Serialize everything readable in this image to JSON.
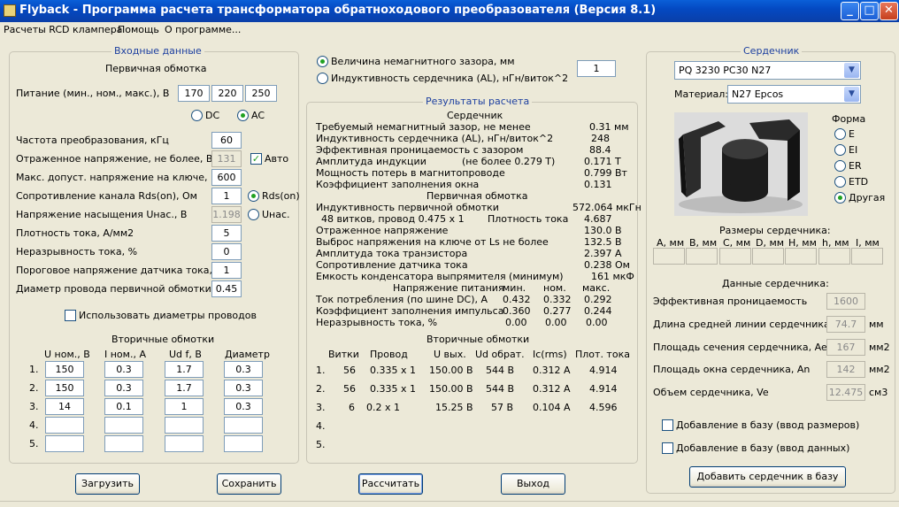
{
  "window": {
    "title": "Flyback - Программа расчета трансформатора обратноходового преобразователя (Версия 8.1)",
    "min": "_",
    "max": "□",
    "close": "✕"
  },
  "menu": [
    "Расчеты RCD клампера",
    "Помощь",
    "О программе..."
  ],
  "input": {
    "title": "Входные данные",
    "primary_title": "Первичная обмотка",
    "supply_label": "Питание (мин., ном., макс.), В",
    "supply": [
      "170",
      "220",
      "250"
    ],
    "dc": "DC",
    "ac": "AC",
    "rows": [
      {
        "label": "Частота преобразования, кГц",
        "value": "60"
      },
      {
        "label": "Отраженное напряжение, не более, В",
        "value": "131"
      },
      {
        "label": "Макс. допуст. напряжение на ключе, В",
        "value": "600"
      },
      {
        "label": "Сопротивление канала Rds(on), Ом",
        "value": "1"
      },
      {
        "label": "Напряжение насыщения Uнас., В",
        "value": "1.198"
      },
      {
        "label": "Плотность тока, А/мм2",
        "value": "5"
      },
      {
        "label": "Неразрывность тока, %",
        "value": "0"
      },
      {
        "label": "Пороговое напряжение датчика тока, В",
        "value": "1"
      },
      {
        "label": "Диаметр провода первичной обмотки",
        "value": "0.45"
      }
    ],
    "auto": "Авто",
    "rds_on": "Rds(on)",
    "u_sat": "Uнас.",
    "use_diam": "Использовать диаметры проводов",
    "secondary_title": "Вторичные обмотки",
    "sec_headers": [
      "U ном., В",
      "I ном., А",
      "Ud f, В",
      "Диаметр"
    ],
    "sec_rows": [
      {
        "n": "1.",
        "v": [
          "150",
          "0.3",
          "1.7",
          "0.3"
        ]
      },
      {
        "n": "2.",
        "v": [
          "150",
          "0.3",
          "1.7",
          "0.3"
        ]
      },
      {
        "n": "3.",
        "v": [
          "14",
          "0.1",
          "1",
          "0.3"
        ]
      },
      {
        "n": "4.",
        "v": [
          "",
          "",
          "",
          ""
        ]
      },
      {
        "n": "5.",
        "v": [
          "",
          "",
          "",
          ""
        ]
      }
    ]
  },
  "gap": {
    "opt1": "Величина немагнитного зазора, мм",
    "opt2": "Индуктивность сердечника (AL), нГн/виток^2",
    "value": "1"
  },
  "results": {
    "title": "Результаты расчета",
    "core_title": "Сердечник",
    "primary_title": "Первичная обмотка",
    "rows_core": [
      {
        "l": "Требуемый немагнитный зазор, не менее",
        "v": "0.31 мм"
      },
      {
        "l": "Индуктивность сердечника (AL), нГн/виток^2",
        "v": "248"
      },
      {
        "l": "Эффективная проницаемость с зазором",
        "v": "88.4"
      },
      {
        "l": "Амплитуда индукции",
        "m": "(не более 0.279 Т)",
        "v": "0.171 Т"
      },
      {
        "l": "Мощность потерь в магнитопроводе",
        "v": "0.799 Вт"
      },
      {
        "l": "Коэффициент заполнения окна",
        "v": "0.131"
      }
    ],
    "rows_prim": [
      {
        "l": "Индуктивность первичной обмотки",
        "v": "572.064 мкГн"
      },
      {
        "l": "  48 витков, провод 0.475 x 1",
        "m": "Плотность тока",
        "v": "4.687"
      },
      {
        "l": "Отраженное напряжение",
        "v": "130.0 В"
      },
      {
        "l": "Выброс напряжения на ключе от Ls не более",
        "v": "132.5 В"
      },
      {
        "l": "Амплитуда тока транзистора",
        "v": "2.397 А"
      },
      {
        "l": "Сопротивление датчика тока",
        "v": "0.238 Ом"
      },
      {
        "l": "Емкость конденсатора выпрямителя (минимум)",
        "v": "161 мкФ"
      }
    ],
    "supply_hdr": {
      "l": "Напряжение питания",
      "c": [
        "мин.",
        "ном.",
        "макс."
      ]
    },
    "supply_rows": [
      {
        "l": "Ток потребления (по шине DC), А",
        "c": [
          "0.432",
          "0.332",
          "0.292"
        ]
      },
      {
        "l": "Коэффициент заполнения импульса",
        "c": [
          "0.360",
          "0.277",
          "0.244"
        ]
      },
      {
        "l": "Неразрывность тока, %",
        "c": [
          "0.00",
          "0.00",
          "0.00"
        ]
      }
    ],
    "sec_title": "Вторичные обмотки",
    "sec_headers": [
      "Витки",
      "Провод",
      "U вых.",
      "Ud обрат.",
      "Ic(rms)",
      "Плот. тока"
    ],
    "sec_rows": [
      {
        "n": "1.",
        "c": [
          "56",
          "0.335 x 1",
          "150.00 В",
          "544 В",
          "0.312 А",
          "4.914"
        ]
      },
      {
        "n": "2.",
        "c": [
          "56",
          "0.335 x 1",
          "150.00 В",
          "544 В",
          "0.312 А",
          "4.914"
        ]
      },
      {
        "n": "3.",
        "c": [
          "6",
          "0.2 x 1",
          "15.25 В",
          "57 В",
          "0.104 А",
          "4.596"
        ]
      },
      {
        "n": "4.",
        "c": [
          "",
          "",
          "",
          "",
          "",
          ""
        ]
      },
      {
        "n": "5.",
        "c": [
          "",
          "",
          "",
          "",
          "",
          ""
        ]
      }
    ]
  },
  "core": {
    "title": "Сердечник",
    "model": "PQ 3230 PC30 N27",
    "material_label": "Материал:",
    "material": "N27 Epcos",
    "shape_label": "Форма",
    "shapes": [
      "E",
      "EI",
      "ER",
      "ETD",
      "Другая"
    ],
    "sizes_title": "Размеры сердечника:",
    "size_headers": [
      "A, мм",
      "B, мм",
      "C, мм",
      "D, мм",
      "H, мм",
      "h, мм",
      "I, мм"
    ],
    "data_title": "Данные сердечника:",
    "data": [
      {
        "l": "Эффективная проницаемость",
        "v": "1600",
        "u": ""
      },
      {
        "l": "Длина средней линии сердечника, le",
        "v": "74.7",
        "u": "мм"
      },
      {
        "l": "Площадь сечения сердечника, Ae",
        "v": "167",
        "u": "мм2"
      },
      {
        "l": "Площадь окна сердечника, An",
        "v": "142",
        "u": "мм2"
      },
      {
        "l": "Объем сердечника, Ve",
        "v": "12.475",
        "u": "см3"
      }
    ],
    "add_sizes": "Добавление в базу (ввод размеров)",
    "add_data": "Добавление в базу (ввод данных)",
    "add_btn": "Добавить сердечник в базу"
  },
  "buttons": {
    "load": "Загрузить",
    "save": "Сохранить",
    "calc": "Рассчитать",
    "exit": "Выход"
  }
}
